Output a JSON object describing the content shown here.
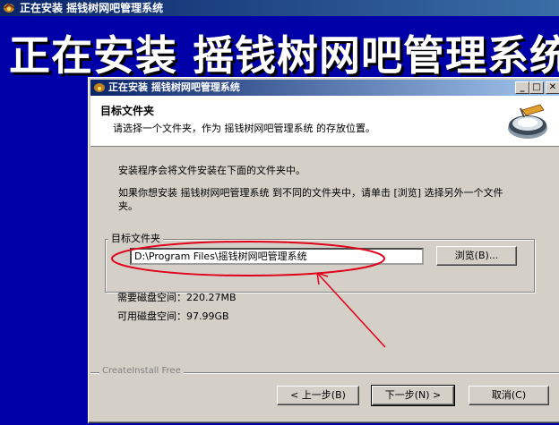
{
  "outer": {
    "title": "正在安装 摇钱树网吧管理系统",
    "big_title": "正在安装 摇钱树网吧管理系统"
  },
  "dialog": {
    "title": "正在安装 摇钱树网吧管理系统",
    "header_title": "目标文件夹",
    "header_subtitle": "请选择一个文件夹，作为 摇钱树网吧管理系统 的存放位置。",
    "intro": "安装程序会将文件安装在下面的文件夹中。",
    "instruction": "如果你想安装 摇钱树网吧管理系统 到不同的文件夹中，请单击 [浏览] 选择另外一个文件夹。",
    "group_label": "目标文件夹",
    "path_value": "D:\\Program Files\\摇钱树网吧管理系统",
    "browse_label": "浏览(B)...",
    "required_space_label": "需要磁盘空间：",
    "required_space_value": "220.27MB",
    "available_space_label": "可用磁盘空间：",
    "available_space_value": "97.99GB",
    "brand": "CreateInstall Free",
    "back_label": "< 上一步(B)",
    "next_label": "下一步(N) >",
    "cancel_label": "取消(C)",
    "minimize_glyph": "_",
    "maximize_glyph": "□",
    "close_glyph": "✕"
  },
  "colors": {
    "background": "#0000a8",
    "annotation": "#e0001a"
  }
}
